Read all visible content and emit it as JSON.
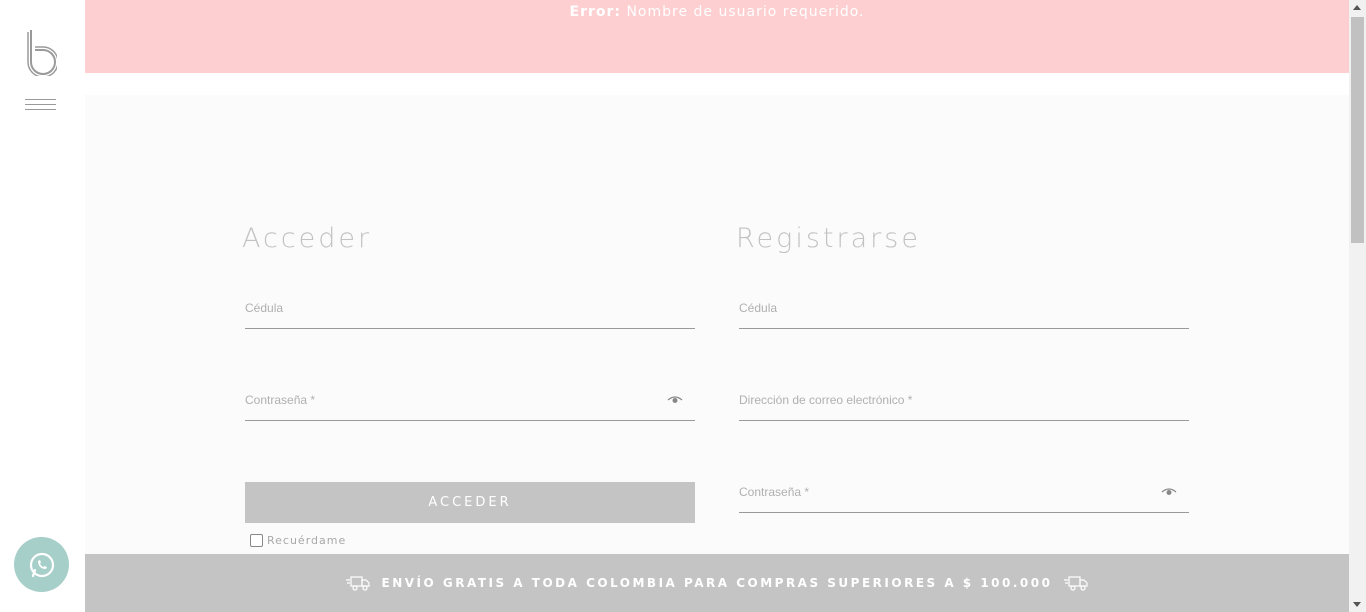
{
  "error": {
    "label": "Error:",
    "message": "Nombre de usuario requerido."
  },
  "login": {
    "title": "Acceder",
    "cedula_placeholder": "Cédula",
    "password_placeholder": "Contraseña *",
    "submit_label": "ACCEDER",
    "remember_label": "Recuérdame",
    "remember_checked": false
  },
  "register": {
    "title": "Registrarse",
    "cedula_placeholder": "Cédula",
    "email_placeholder": "Dirección de correo electrónico *",
    "password_placeholder": "Contraseña *"
  },
  "shipping": {
    "text": "ENVÍO GRATIS A TODA COLOMBIA PARA COMPRAS SUPERIORES A $ 100.000"
  },
  "icons": {
    "logo": "brand-b-logo",
    "menu": "hamburger-icon",
    "whatsapp": "whatsapp-icon",
    "eye": "eye-icon",
    "truck": "truck-icon"
  },
  "colors": {
    "error_bg": "#fecfd0",
    "button_bg": "#c4c4c4",
    "whatsapp_bg": "#a6cfc9",
    "main_bg": "#fbfbfb"
  }
}
